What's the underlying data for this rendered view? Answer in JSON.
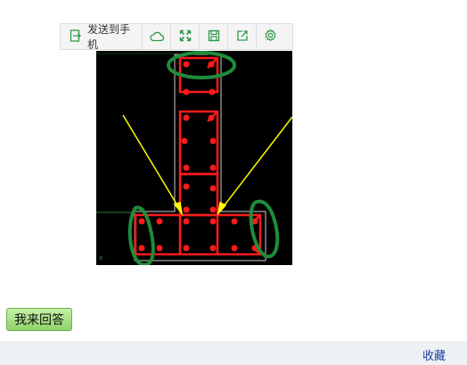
{
  "toolbar": {
    "send_label": "发送到手机",
    "icons": [
      "cloud-icon",
      "fullscreen-icon",
      "save-icon",
      "share-icon",
      "settings-icon"
    ]
  },
  "answer_button": "我来回答",
  "footer": {
    "favorite": "收藏"
  },
  "colors": {
    "toolbar_icon": "#2e9a4a",
    "rebar": "#ff1a1a",
    "markup_circle": "#1e8c3a",
    "arrow": "#ffff00"
  }
}
